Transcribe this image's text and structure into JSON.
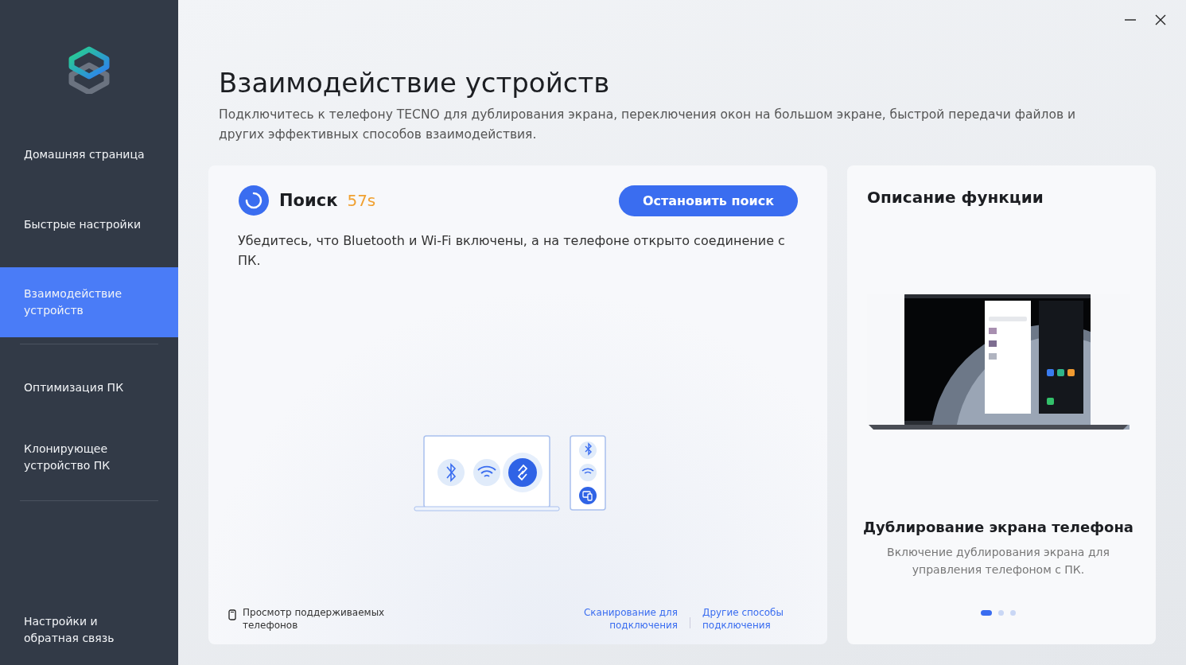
{
  "sidebar": {
    "items": [
      {
        "label": "Домашняя страница",
        "selected": false,
        "divider_after": false
      },
      {
        "label": "Быстрые настройки",
        "selected": false,
        "divider_after": false
      },
      {
        "label": "Взаимодействие устройств",
        "selected": true,
        "divider_after": true
      },
      {
        "label": "Оптимизация ПК",
        "selected": false,
        "divider_after": false
      },
      {
        "label": "Клонирующее устройство ПК",
        "selected": false,
        "divider_after": true
      }
    ],
    "footer": "Настройки и обратная связь"
  },
  "header": {
    "title": "Взаимодействие устройств",
    "subtitle": "Подключитесь к телефону TECNO для дублирования экрана, переключения окон на большом экране, быстрой передачи файлов и других эффективных способов взаимодействия."
  },
  "search_card": {
    "status": "Поиск",
    "timer": "57s",
    "stop_button": "Остановить поиск",
    "hint": "Убедитесь, что Bluetooth и Wi-Fi включены, а на телефоне открыто соединение с ПК.",
    "supported_link": "Просмотр поддерживаемых телефонов",
    "links": [
      "Сканирование для подключения",
      "Другие способы подключения"
    ]
  },
  "feature_card": {
    "title": "Описание функции",
    "feature_title": "Дублирование экрана телефона",
    "feature_text": "Включение дублирования экрана для управления телефоном с ПК.",
    "pages": [
      {
        "selected": true
      },
      {
        "selected": false
      },
      {
        "selected": false
      }
    ]
  }
}
